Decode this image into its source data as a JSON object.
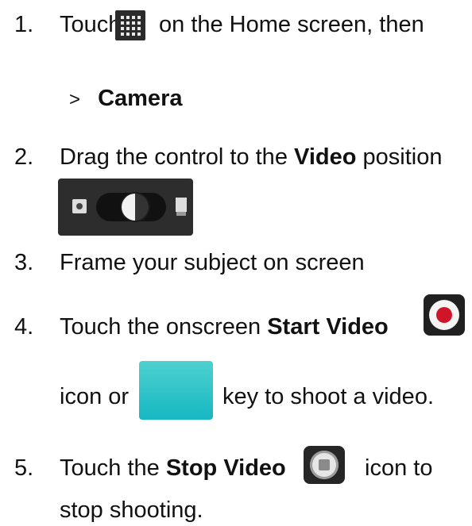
{
  "steps": [
    {
      "number": "1.",
      "before": "Touch",
      "after": "on the Home screen, then"
    },
    {
      "arrow": ">",
      "bold": "Camera"
    },
    {
      "number": "2.",
      "before": "Drag the control to the",
      "bold": "Video",
      "after": "position"
    },
    {
      "number": "3.",
      "text": "Frame your subject on screen"
    },
    {
      "number": "4.",
      "before": "Touch the onscreen",
      "bold": "Start Video"
    },
    {
      "before": "icon or",
      "after": "key to shoot a video."
    },
    {
      "number": "5.",
      "before": "Touch the",
      "bold": "Stop Video",
      "after": "icon to"
    },
    {
      "text": "stop shooting."
    }
  ],
  "icons": {
    "apps": "apps-grid-icon",
    "switch": "video-camera-switch-icon",
    "start": "start-video-icon",
    "key": "camera-key-icon",
    "stop": "stop-video-icon"
  },
  "colors": {
    "record": "#d0152b",
    "key_teal": "#16b7c3"
  }
}
